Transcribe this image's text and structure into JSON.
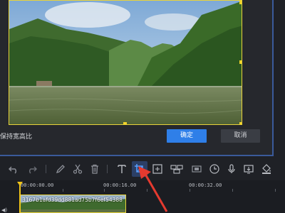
{
  "dialog": {
    "keep_ratio_label": "保持宽高比",
    "confirm_label": "确定",
    "cancel_label": "取消"
  },
  "toolbar": {
    "tools": [
      "undo-icon",
      "redo-icon",
      "pen-icon",
      "scissors-icon",
      "trash-icon",
      "text-icon",
      "crop-icon",
      "fit-icon",
      "mosaic-icon",
      "frame-icon",
      "timer-icon",
      "mic-icon",
      "screen-record-icon",
      "bucket-icon"
    ]
  },
  "timeline": {
    "time_labels": [
      "00:00:00.00",
      "00:00:16.00",
      "00:00:32.00"
    ],
    "clip_name": "3167b1afd39dd881ad75b7f6ef54388"
  },
  "colors": {
    "accent": "#2f7fe8",
    "selection": "#e8d23a",
    "annotation": "#e53a2f"
  }
}
